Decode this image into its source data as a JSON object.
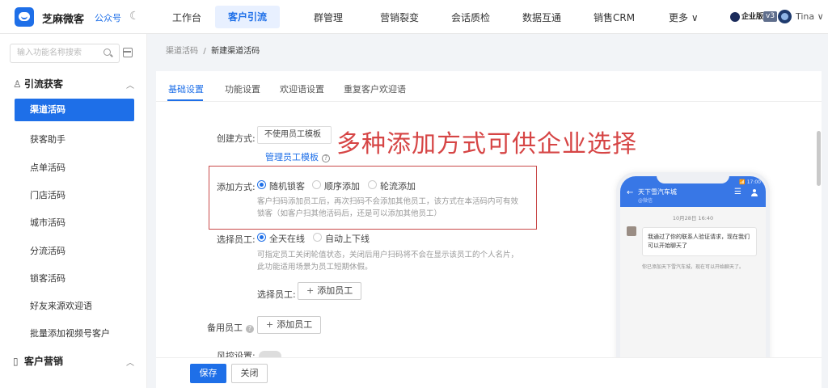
{
  "app": {
    "brand": "芝麻微客",
    "account_type": "公众号",
    "edition_badge": "企业版",
    "version": "v3",
    "username": "Tina"
  },
  "top_nav": [
    {
      "label": "工作台",
      "active": false
    },
    {
      "label": "客户引流",
      "active": true
    },
    {
      "label": "群管理",
      "active": false
    },
    {
      "label": "营销裂变",
      "active": false
    },
    {
      "label": "会话质检",
      "active": false
    },
    {
      "label": "数据互通",
      "active": false
    },
    {
      "label": "销售CRM",
      "active": false
    },
    {
      "label": "更多 ∨",
      "active": false
    }
  ],
  "sidebar": {
    "search_placeholder": "输入功能名称搜索",
    "sections": [
      {
        "title": "引流获客",
        "icon": "user-icon",
        "items": [
          {
            "label": "渠道活码",
            "active": true
          },
          {
            "label": "获客助手",
            "active": false
          },
          {
            "label": "点单活码",
            "active": false
          },
          {
            "label": "门店活码",
            "active": false
          },
          {
            "label": "城市活码",
            "active": false
          },
          {
            "label": "分流活码",
            "active": false
          },
          {
            "label": "锁客活码",
            "active": false
          },
          {
            "label": "好友来源欢迎语",
            "active": false
          },
          {
            "label": "批量添加视频号客户",
            "active": false
          }
        ]
      },
      {
        "title": "客户营销",
        "icon": "document-icon",
        "items": []
      }
    ]
  },
  "breadcrumb": {
    "parent": "渠道活码",
    "separator": "/",
    "current": "新建渠道活码"
  },
  "tabs": [
    {
      "label": "基础设置",
      "active": true
    },
    {
      "label": "功能设置",
      "active": false
    },
    {
      "label": "欢迎语设置",
      "active": false
    },
    {
      "label": "重复客户欢迎语",
      "active": false
    }
  ],
  "form": {
    "create_method": {
      "label": "创建方式:",
      "value": "不使用员工模板",
      "link": "管理员工模板"
    },
    "add_method": {
      "label": "添加方式:",
      "options": [
        {
          "label": "随机锁客",
          "checked": true
        },
        {
          "label": "顺序添加",
          "checked": false
        },
        {
          "label": "轮流添加",
          "checked": false
        }
      ],
      "hint": [
        "客户扫码添加员工后，再次扫码不会添加其他员工，该方式在本活码内可有效",
        "锁客（如客户扫其他活码后，还是可以添加其他员工）"
      ]
    },
    "select_staff": {
      "label": "选择员工:",
      "options": [
        {
          "label": "全天在线",
          "checked": true
        },
        {
          "label": "自动上下线",
          "checked": false
        }
      ],
      "hint": [
        "可指定员工关闭轮值状态，关闭后用户扫码将不会在显示该员工的个人名片，",
        "此功能适用场景为员工短期休假。"
      ],
      "sub_label": "选择员工:",
      "add_button": "添加员工"
    },
    "backup_staff": {
      "label": "备用员工",
      "add_button": "添加员工"
    },
    "risk_control": {
      "label": "风控设置:"
    }
  },
  "caption": "多种添加方式可供企业选择",
  "phone_preview": {
    "status": "📶 17:00",
    "title": "天下雪汽车城",
    "subtitle": "@微信",
    "time": "10月28日 16:40",
    "message": "我通过了你的联系人验证请求，现在我们可以开始聊天了",
    "note": "你已添加天下雪汽车城，现在可以开始聊天了。"
  },
  "footer": {
    "save": "保存",
    "close": "关闭"
  },
  "colors": {
    "accent": "#1e6fe8",
    "caption": "#d64545",
    "highlight_border": "#c94a4a"
  }
}
